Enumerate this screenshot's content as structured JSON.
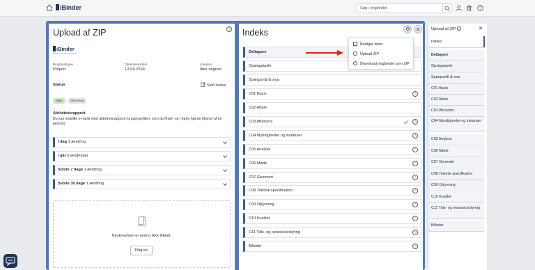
{
  "topbar": {
    "logo": "iBinder",
    "search_placeholder": "Søg i ringbindet"
  },
  "left": {
    "title": "Upload af ZIP",
    "org_logo_text": "iBinder",
    "org_tagline": "Fundament for teamwork",
    "fields": [
      {
        "label": "Ringbindstype",
        "value": "Projekt"
      },
      {
        "label": "Oprettelsesdato",
        "value": "12.04.2024"
      },
      {
        "label": "Lokation",
        "value": "Ikke angivet"
      }
    ],
    "status_label": "Status",
    "change_status": "Skift status",
    "badges": [
      "Aktiv",
      "Skitsering"
    ],
    "activity_title": "Aktivitetsrapport",
    "activity_text": "Du kan indstille e-mails med aktivitetsrapport i brugerprofilen, som du finder op i højre hjørne (ikonet af en person).",
    "periods": [
      {
        "label": "I dag",
        "count": "1 ændring"
      },
      {
        "label": "I går",
        "count": "0 ændringer"
      },
      {
        "label": "Sidste 7 dage",
        "count": "1 ændring"
      },
      {
        "label": "Sidste 30 dage",
        "count": "1 ændring"
      }
    ],
    "description_empty": "Beskrivelsen er endnu ikke tilføjet.",
    "add_now": "Tilføj nu!"
  },
  "index": {
    "title": "Indeks",
    "rows": [
      "Deltagere",
      "Opslagstavle",
      "Spørgsmål & svar",
      "C01 Basis",
      "C02 Aftale",
      "C03 Økonomi",
      "C04 Myndigheder og instanser",
      "C05 Analyse",
      "C06 Møde",
      "C07 Geometri",
      "C08 Teknisk specifikation",
      "C09 Oplysning",
      "C10 Kvalitet",
      "C11 Tids- og ressourcestyring",
      "Billeder"
    ],
    "menu": [
      "Rediger faner",
      "Upload ZIP",
      "Download ringbindet som ZIP"
    ]
  },
  "side": {
    "title": "Upload af ZIP",
    "items": [
      "Indeks",
      "Deltagere",
      "Opslagstavle",
      "Spørgsmål & svar",
      "C01 Basis",
      "C02 Aftale",
      "C03 Økonomi",
      "C04 Myndigheder og instanser",
      "C05 Analyse",
      "C06 Møde",
      "C07 Geometri",
      "C08 Teknisk specifikation",
      "C09 Oplysning",
      "C10 Kvalitet",
      "C11 Tids- og ressourcestyring",
      "Billeder"
    ]
  },
  "colors": {
    "accent": "#3a5a99",
    "stage": "#4f79c2",
    "arrow": "#e0201b"
  }
}
